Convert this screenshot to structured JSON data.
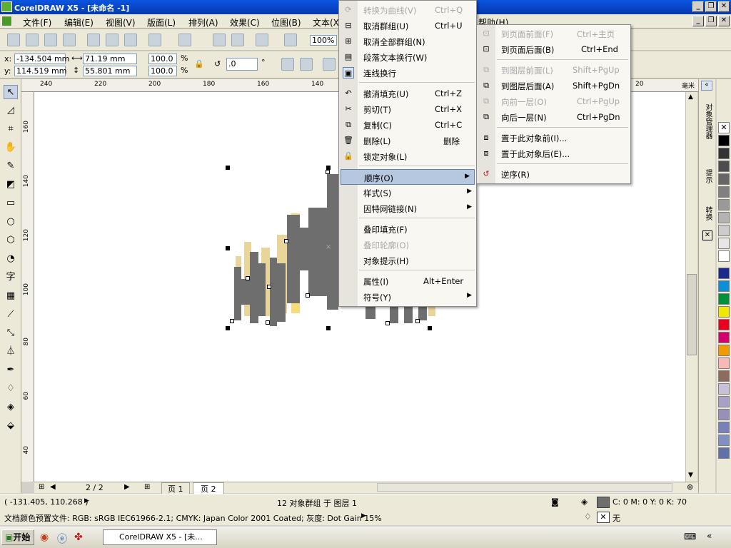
{
  "window": {
    "title": "CorelDRAW X5 - [未命名 -1]"
  },
  "menubar": [
    "文件(F)",
    "编辑(E)",
    "视图(V)",
    "版面(L)",
    "排列(A)",
    "效果(C)",
    "位图(B)",
    "文本(X)",
    "帮助(H)"
  ],
  "propbar": {
    "x": "-134.504 mm",
    "y": "114.519 mm",
    "w": "71.19 mm",
    "h": "55.801 mm",
    "scale_x": "100.0",
    "scale_y": "100.0",
    "pct": "%",
    "angle": ".0",
    "deg": "°",
    "zoom": "100%",
    "x_label": "x:",
    "y_label": "y:"
  },
  "ruler_top": [
    "240",
    "220",
    "200",
    "180",
    "160",
    "140",
    "20",
    "毫米"
  ],
  "ruler_left": [
    "160",
    "140",
    "120",
    "100",
    "80",
    "60",
    "40"
  ],
  "pages": {
    "counter": "2 / 2",
    "tabs": [
      "页 1",
      "页 2"
    ]
  },
  "docker_tabs": [
    "对象管理器",
    "提示",
    "转换"
  ],
  "context_menu": {
    "items": [
      {
        "label": "转换为曲线(V)",
        "shortcut": "Ctrl+Q",
        "disabled": true,
        "icon": "convert-curve-icon"
      },
      {
        "label": "取消群组(U)",
        "shortcut": "Ctrl+U",
        "disabled": false,
        "icon": "ungroup-icon"
      },
      {
        "label": "取消全部群组(N)",
        "shortcut": "",
        "disabled": false,
        "icon": "ungroup-all-icon"
      },
      {
        "label": "段落文本换行(W)",
        "shortcut": "",
        "disabled": false,
        "icon": "text-wrap-icon"
      },
      {
        "label": "连线换行",
        "shortcut": "",
        "disabled": false,
        "icon": "line-wrap-icon"
      },
      {
        "label": "撤消填充(U)",
        "shortcut": "Ctrl+Z",
        "disabled": false,
        "icon": "undo-icon"
      },
      {
        "label": "剪切(T)",
        "shortcut": "Ctrl+X",
        "disabled": false,
        "icon": "cut-icon"
      },
      {
        "label": "复制(C)",
        "shortcut": "Ctrl+C",
        "disabled": false,
        "icon": "copy-icon"
      },
      {
        "label": "删除(L)",
        "shortcut": "删除",
        "disabled": false,
        "icon": "delete-icon"
      },
      {
        "label": "锁定对象(L)",
        "shortcut": "",
        "disabled": false,
        "icon": "lock-icon"
      },
      {
        "label": "顺序(O)",
        "shortcut": "",
        "disabled": false,
        "submenu": true,
        "highlighted": true
      },
      {
        "label": "样式(S)",
        "shortcut": "",
        "disabled": false,
        "submenu": true
      },
      {
        "label": "因特网链接(N)",
        "shortcut": "",
        "disabled": false,
        "submenu": true
      },
      {
        "label": "叠印填充(F)",
        "shortcut": "",
        "disabled": false
      },
      {
        "label": "叠印轮廓(O)",
        "shortcut": "",
        "disabled": true
      },
      {
        "label": "对象提示(H)",
        "shortcut": "",
        "disabled": false
      },
      {
        "label": "属性(I)",
        "shortcut": "Alt+Enter",
        "disabled": false
      },
      {
        "label": "符号(Y)",
        "shortcut": "",
        "disabled": false,
        "submenu": true
      }
    ]
  },
  "order_submenu": {
    "items": [
      {
        "label": "到页面前面(F)",
        "shortcut": "Ctrl+主页",
        "disabled": true
      },
      {
        "label": "到页面后面(B)",
        "shortcut": "Ctrl+End",
        "disabled": false
      },
      {
        "label": "到图层前面(L)",
        "shortcut": "Shift+PgUp",
        "disabled": true
      },
      {
        "label": "到图层后面(A)",
        "shortcut": "Shift+PgDn",
        "disabled": false
      },
      {
        "label": "向前一层(O)",
        "shortcut": "Ctrl+PgUp",
        "disabled": true
      },
      {
        "label": "向后一层(N)",
        "shortcut": "Ctrl+PgDn",
        "disabled": false
      },
      {
        "label": "置于此对象前(I)...",
        "shortcut": "",
        "disabled": false
      },
      {
        "label": "置于此对象后(E)...",
        "shortcut": "",
        "disabled": false
      },
      {
        "label": "逆序(R)",
        "shortcut": "",
        "disabled": false
      }
    ]
  },
  "status": {
    "coords": "( -131.405, 110.268 )",
    "selection": "12 对象群组 于 图层 1",
    "fill": "C: 0 M: 0 Y: 0 K: 70",
    "outline": "无",
    "profile": "文档颜色预置文件: RGB: sRGB IEC61966-2.1; CMYK: Japan Color 2001 Coated; 灰度: Dot Gain 15%"
  },
  "taskbar": {
    "start": "开始",
    "task": "CorelDRAW X5 - [未..."
  },
  "colors": {
    "gray": "#6e6e6e",
    "tan": "#e9d59a",
    "yellow": "#f7dc7a",
    "highlight": "#b6c7e0"
  }
}
